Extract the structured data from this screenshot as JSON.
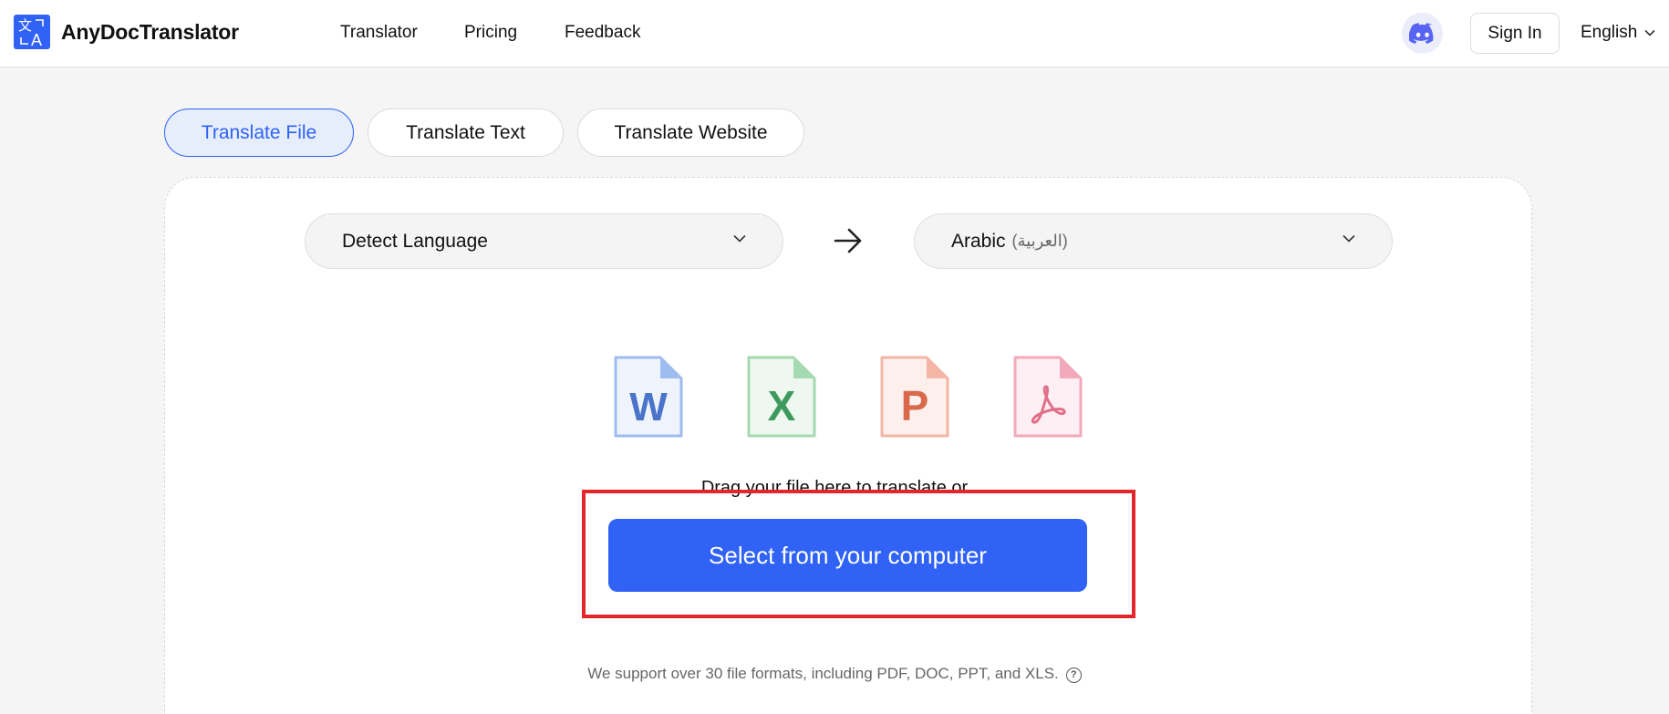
{
  "header": {
    "brand": "AnyDocTranslator",
    "nav": [
      "Translator",
      "Pricing",
      "Feedback"
    ],
    "sign_in": "Sign In",
    "language": "English"
  },
  "tabs": [
    {
      "label": "Translate File",
      "active": true
    },
    {
      "label": "Translate Text",
      "active": false
    },
    {
      "label": "Translate Website",
      "active": false
    }
  ],
  "translator": {
    "source_language": "Detect Language",
    "target_language": "Arabic",
    "target_language_native": "(العربية)"
  },
  "file_types": [
    {
      "letter": "W",
      "icon": "word-file-icon",
      "color": "#4a74c9"
    },
    {
      "letter": "X",
      "icon": "excel-file-icon",
      "color": "#3e9a5c"
    },
    {
      "letter": "P",
      "icon": "powerpoint-file-icon",
      "color": "#d9694a"
    },
    {
      "letter": "",
      "icon": "pdf-file-icon",
      "color": "#e0708a"
    }
  ],
  "upload": {
    "drag_text": "Drag your file here to translate or",
    "select_button": "Select from your computer",
    "support_text": "We support over 30 file formats, including PDF, DOC, PPT, and XLS.",
    "help_glyph": "?"
  },
  "colors": {
    "accent": "#2f62f5",
    "highlight": "#e3262a"
  }
}
